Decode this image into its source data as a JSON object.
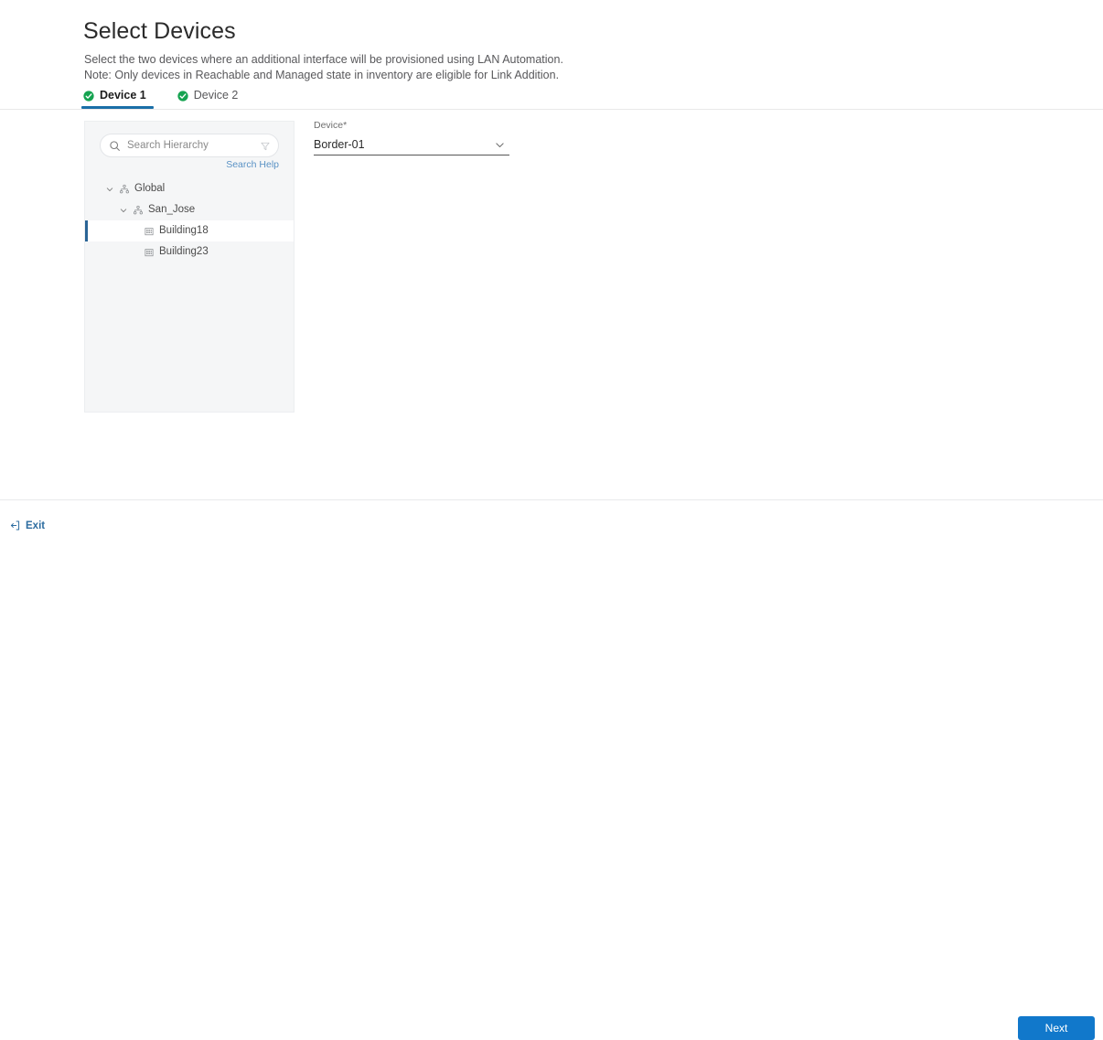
{
  "page": {
    "title": "Select Devices",
    "description_line_1": "Select the two devices where an additional interface will be provisioned using LAN Automation.",
    "description_line_2": "Note: Only devices in Reachable and Managed state in inventory are eligible for Link Addition."
  },
  "tabs": [
    {
      "label": "Device 1",
      "status_icon": "check-circle-icon",
      "active": true
    },
    {
      "label": "Device 2",
      "status_icon": "check-circle-icon",
      "active": false
    }
  ],
  "hierarchy_panel": {
    "search": {
      "placeholder": "Search Hierarchy",
      "value": "",
      "search_icon": "search-icon",
      "filter_icon": "filter-icon"
    },
    "search_help_label": "Search Help",
    "tree": [
      {
        "label": "Global",
        "level": 1,
        "icon": "sitemap-icon",
        "expanded": true,
        "has_chevron": true,
        "selected": false
      },
      {
        "label": "San_Jose",
        "level": 2,
        "icon": "sitemap-icon",
        "expanded": true,
        "has_chevron": true,
        "selected": false
      },
      {
        "label": "Building18",
        "level": 3,
        "icon": "building-icon",
        "expanded": false,
        "has_chevron": false,
        "selected": true
      },
      {
        "label": "Building23",
        "level": 3,
        "icon": "building-icon",
        "expanded": false,
        "has_chevron": false,
        "selected": false
      }
    ]
  },
  "device_field": {
    "label": "Device*",
    "value": "Border-01",
    "chevron_icon": "chevron-down-icon"
  },
  "footer": {
    "exit_label": "Exit",
    "exit_icon": "exit-icon",
    "next_label": "Next"
  },
  "colors": {
    "accent_blue": "#1178cb",
    "tab_underline": "#1a6fa8",
    "status_green": "#15a350",
    "link_blue": "#2c6ca0",
    "panel_background": "#f5f6f7",
    "selection_bar": "#2a6496"
  }
}
